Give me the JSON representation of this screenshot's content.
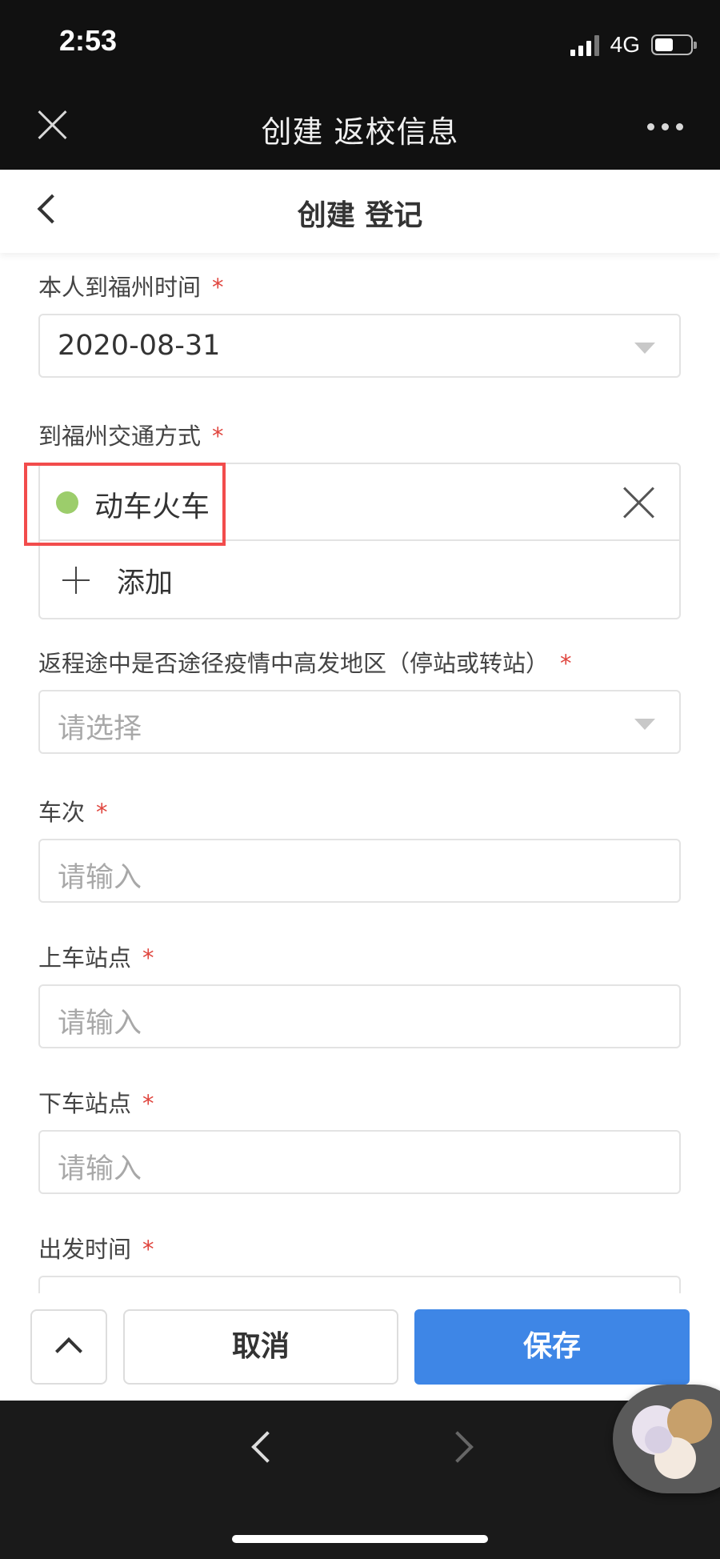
{
  "status_bar": {
    "time": "2:53",
    "network": "4G"
  },
  "wx_header": {
    "title": "创建 返校信息"
  },
  "page_header": {
    "title": "创建 登记"
  },
  "form": {
    "arrival_time": {
      "label": "本人到福州时间",
      "required_mark": "*",
      "value": "2020-08-31"
    },
    "transport": {
      "label": "到福州交通方式",
      "required_mark": "*",
      "selected": "动车火车",
      "add_label": "添加"
    },
    "risk_area": {
      "label": "返程途中是否途径疫情中高发地区（停站或转站）",
      "required_mark": "*",
      "placeholder": "请选择"
    },
    "train_no": {
      "label": "车次",
      "required_mark": "*",
      "placeholder": "请输入"
    },
    "board_station": {
      "label": "上车站点",
      "required_mark": "*",
      "placeholder": "请输入"
    },
    "alight_station": {
      "label": "下车站点",
      "required_mark": "*",
      "placeholder": "请输入"
    },
    "depart_time": {
      "label": "出发时间",
      "required_mark": "*"
    }
  },
  "actions": {
    "cancel_label": "取消",
    "save_label": "保存"
  },
  "colors": {
    "primary": "#3e86e6",
    "required": "#e0463f",
    "tag_dot": "#9ccd6b",
    "highlight": "#f24c4c"
  },
  "icons": [
    "close-icon",
    "more-icon",
    "back-icon",
    "chevron-down-icon",
    "remove-icon",
    "plus-icon",
    "chevron-up-icon",
    "nav-back-icon",
    "nav-forward-icon"
  ]
}
